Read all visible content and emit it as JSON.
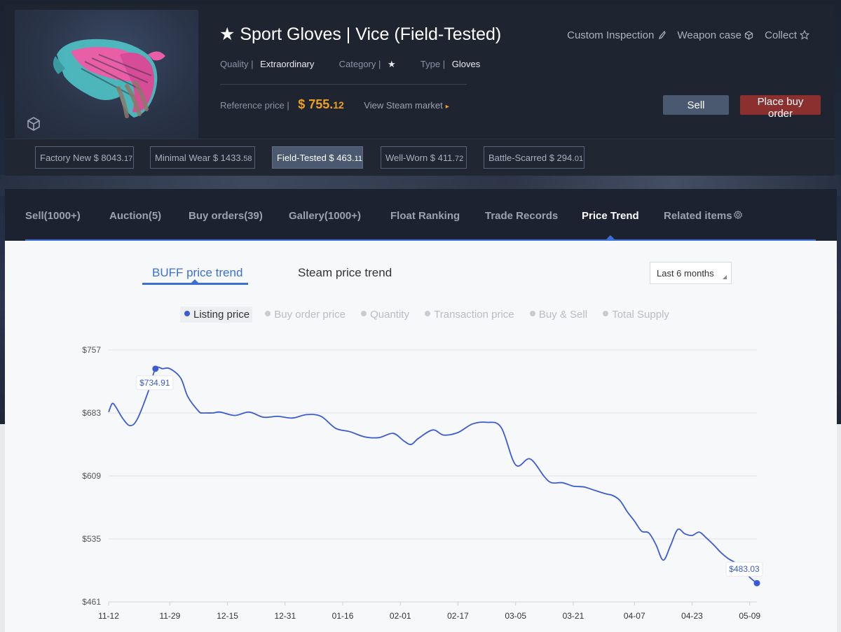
{
  "item": {
    "title": "★ Sport Gloves | Vice (Field-Tested)",
    "quality_label": "Quality |",
    "quality_value": "Extraordinary",
    "category_label": "Category |",
    "category_value": "★",
    "type_label": "Type |",
    "type_value": "Gloves",
    "ref_price_label": "Reference price |",
    "ref_price_main": "$ 755.",
    "ref_price_cents": "12",
    "steam_market_link": "View Steam market",
    "image_icon": "sport-gloves-vice-image"
  },
  "top_links": {
    "custom_inspection": "Custom Inspection",
    "weapon_case": "Weapon case",
    "collect": "Collect"
  },
  "actions": {
    "sell": "Sell",
    "place_buy_order": "Place buy order"
  },
  "wear_options": [
    {
      "label": "Factory New $ 8043.",
      "cents": "17"
    },
    {
      "label": "Minimal Wear $ 1433.",
      "cents": "58"
    },
    {
      "label": "Field-Tested $ 463.",
      "cents": "11",
      "active": true
    },
    {
      "label": "Well-Worn $ 411.",
      "cents": "72"
    },
    {
      "label": "Battle-Scarred $ 294.",
      "cents": "01"
    }
  ],
  "tabs": [
    "Sell(1000+)",
    "Auction(5)",
    "Buy orders(39)",
    "Gallery(1000+)",
    "Float Ranking",
    "Trade Records",
    "Price Trend",
    "Related items"
  ],
  "active_tab": "Price Trend",
  "trend_tabs": {
    "buff": "BUFF price trend",
    "steam": "Steam price trend"
  },
  "range_select": "Last 6 months",
  "legend": [
    "Listing price",
    "Buy order price",
    "Quantity",
    "Transaction price",
    "Buy & Sell",
    "Total Supply"
  ],
  "colors": {
    "accent": "#3b6fd3",
    "line": "#3b5bd6",
    "price": "#f0a020",
    "buy_button": "#8b2f2f"
  },
  "chart_data": {
    "type": "line",
    "series": [
      {
        "name": "Listing price",
        "x": [
          0,
          1,
          2,
          4,
          6,
          8,
          11,
          13,
          15,
          17,
          20,
          22,
          25,
          26,
          27,
          29,
          31,
          35,
          39,
          43,
          47,
          51,
          55,
          59,
          63,
          67,
          71,
          75,
          79,
          82,
          84,
          86,
          90,
          93,
          97,
          101,
          105,
          109,
          113,
          117,
          121,
          123,
          126,
          129,
          132,
          135,
          138,
          140,
          142,
          144,
          146,
          148,
          150,
          152,
          154,
          156,
          158,
          160,
          162,
          164,
          166,
          168,
          170,
          172,
          174,
          176,
          178,
          180
        ],
        "values": [
          684,
          694,
          690,
          676,
          668,
          676,
          708,
          735,
          735,
          735,
          724,
          702,
          685,
          683,
          683,
          683,
          684,
          680,
          684,
          678,
          679,
          677,
          681,
          679,
          665,
          661,
          655,
          654,
          659,
          650,
          646,
          653,
          663,
          657,
          660,
          670,
          672,
          666,
          622,
          629,
          608,
          601,
          601,
          597,
          596,
          592,
          588,
          586,
          580,
          567,
          556,
          544,
          542,
          528,
          510,
          527,
          546,
          541,
          539,
          543,
          536,
          528,
          519,
          512,
          507,
          500,
          490,
          483
        ]
      }
    ],
    "annotations": [
      {
        "label": "$734.91",
        "x": 13,
        "value": 734.91
      },
      {
        "label": "$483.03",
        "x": 180,
        "value": 483.03
      }
    ],
    "x_tick_labels": [
      "11-12",
      "11-29",
      "12-15",
      "12-31",
      "01-16",
      "02-01",
      "02-17",
      "03-05",
      "03-21",
      "04-07",
      "04-23",
      "05-09"
    ],
    "x_ticks": [
      0,
      17,
      33,
      49,
      65,
      81,
      97,
      113,
      129,
      146,
      162,
      178
    ],
    "xlim": [
      0,
      180
    ],
    "y_tick_labels": [
      "$757",
      "$683",
      "$609",
      "$535",
      "$461"
    ],
    "y_ticks": [
      757,
      683,
      609,
      535,
      461
    ],
    "ylim": [
      461,
      757
    ],
    "grid": true
  }
}
